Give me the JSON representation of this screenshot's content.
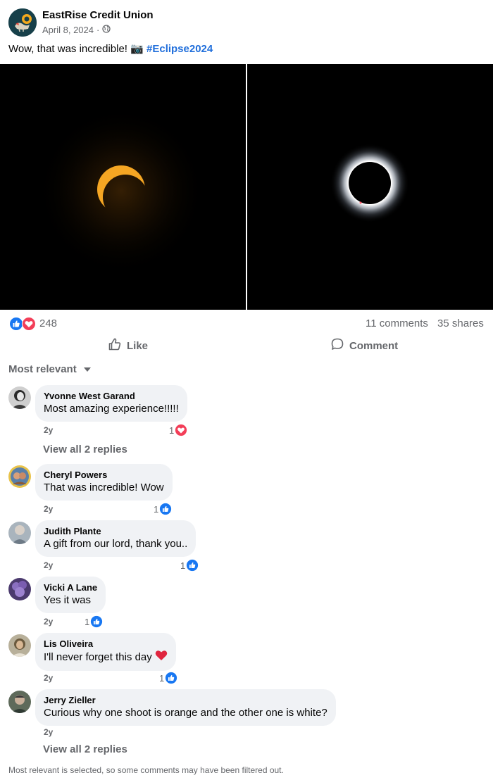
{
  "post": {
    "page_name": "EastRise Credit Union",
    "date": "April 8, 2024",
    "date_separator": " · ",
    "visibility_icon": "globe-icon",
    "text": "Wow, that was incredible! ",
    "camera_emoji": "📷",
    "hashtag": "#Eclipse2024"
  },
  "stats": {
    "reaction_count": "248",
    "comments": "11 comments",
    "shares": "35 shares",
    "reaction_icons": [
      "like-icon",
      "love-icon"
    ]
  },
  "actions": {
    "like_label": "Like",
    "comment_label": "Comment"
  },
  "sort": {
    "label": "Most relevant"
  },
  "comments": [
    {
      "author": "Yvonne West Garand",
      "text": "Most amazing experience!!!!!",
      "age": "2y",
      "reaction_count": "1",
      "reaction": "love-icon",
      "replies": "View all 2 replies"
    },
    {
      "author": "Cheryl Powers",
      "text": "That was incredible! Wow",
      "age": "2y",
      "reaction_count": "1",
      "reaction": "like-icon"
    },
    {
      "author": "Judith Plante",
      "text": "A gift from our lord, thank you..",
      "age": "2y",
      "reaction_count": "1",
      "reaction": "like-icon"
    },
    {
      "author": "Vicki A Lane",
      "text": "Yes it was",
      "age": "2y",
      "reaction_count": "1",
      "reaction": "like-icon"
    },
    {
      "author": "Lis Oliveira",
      "text": "I'll never forget this day",
      "emoji": "❤️",
      "age": "2y",
      "reaction_count": "1",
      "reaction": "like-icon"
    },
    {
      "author": "Jerry Zieller",
      "text": "Curious why one shoot is orange and the other one is white?",
      "age": "2y",
      "replies": "View all 2 replies"
    }
  ],
  "footer": {
    "note": "Most relevant is selected, so some comments may have been filtered out."
  },
  "colors": {
    "link_blue": "#216fdb",
    "like_blue": "#1877f2",
    "love_red": "#f33e58",
    "muted_text": "#65676b",
    "bubble_bg": "#f0f2f5"
  }
}
